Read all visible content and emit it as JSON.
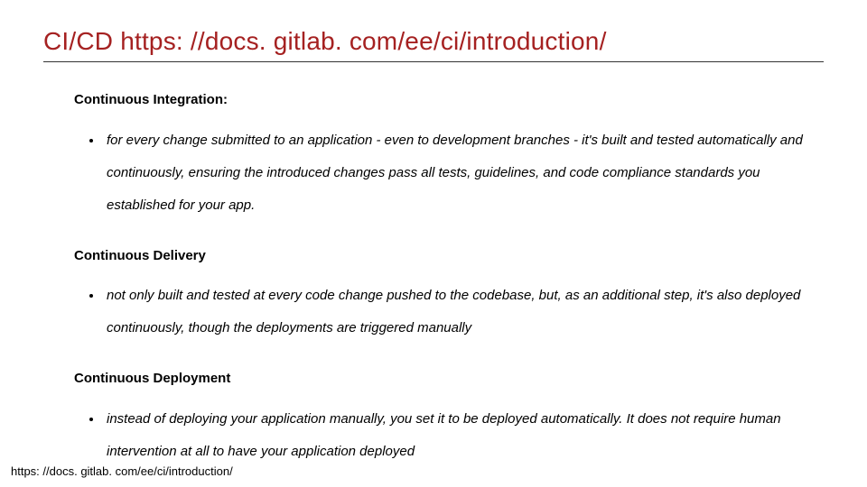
{
  "title": "CI/CD https: //docs. gitlab. com/ee/ci/introduction/",
  "sections": [
    {
      "heading": "Continuous Integration:",
      "bullet": "for every change submitted to an application - even to development branches - it's built and tested automatically and continuously, ensuring the introduced changes pass all tests, guidelines, and code compliance standards you established for your app."
    },
    {
      "heading": "Continuous Delivery",
      "bullet": "not only built and tested at every code change pushed to the codebase, but, as an additional step, it's also deployed continuously, though the deployments are triggered manually"
    },
    {
      "heading": "Continuous Deployment",
      "bullet": "instead of deploying your application manually, you set it to be deployed automatically. It does not require human intervention at all to have your application deployed"
    }
  ],
  "footer": "https: //docs. gitlab. com/ee/ci/introduction/"
}
